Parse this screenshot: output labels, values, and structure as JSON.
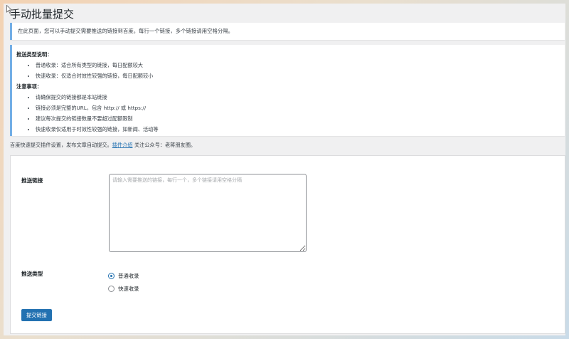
{
  "page": {
    "title": "手动批量提交",
    "notice": "在此页面，您可以手动提交需要推送的链接到百度。每行一个链接，多个链接请用空格分隔。"
  },
  "info": {
    "types_heading": "推送类型说明：",
    "types": [
      "普通收录：适合所有类型的链接，每日配额较大",
      "快速收录：仅适合时效性较强的链接，每日配额较小"
    ],
    "notes_heading": "注意事项：",
    "notes": [
      "请确保提交的链接都是本站链接",
      "链接必须是完整的URL，包含 http:// 或 https://",
      "建议每次提交的链接数量不要超过配额限制",
      "快速收录仅适用于时效性较强的链接，如新闻、活动等"
    ]
  },
  "promo": {
    "prefix": "百度快速提交插件设置，发布文章自动提交。",
    "link": "插件介绍",
    "suffix": " 关注公众号：老蒋朋友圈。"
  },
  "form": {
    "links_label": "推送链接",
    "links_value": "",
    "links_placeholder": "请输入需要推送的链接，每行一个，多个链接请用空格分隔",
    "type_label": "推送类型",
    "options": [
      {
        "label": "普通收录",
        "checked": true
      },
      {
        "label": "快速收录",
        "checked": false
      }
    ],
    "submit_label": "提交链接"
  },
  "colors": {
    "accent": "#2271b1",
    "notice_border": "#72aee6"
  }
}
